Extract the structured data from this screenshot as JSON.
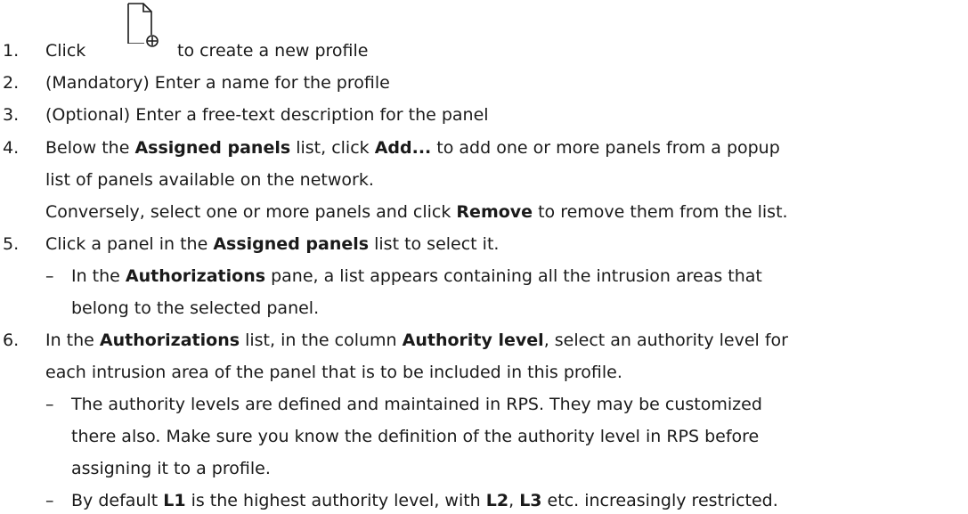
{
  "steps": {
    "s1": {
      "num": "1.",
      "a": "Click",
      "b": "to create a new profile"
    },
    "s2": {
      "num": "2.",
      "a": "(Mandatory) Enter a name for the profile"
    },
    "s3": {
      "num": "3.",
      "a": "(Optional) Enter a free-text description for the panel"
    },
    "s4": {
      "num": "4.",
      "a": "Below the ",
      "b": "Assigned panels",
      "c": " list, click ",
      "d": "Add...",
      "e": " to add one or more panels from a popup",
      "l2": "list of panels available on the network.",
      "l3a": "Conversely, select one or more panels and click ",
      "l3b": "Remove",
      "l3c": " to remove them from the list."
    },
    "s5": {
      "num": "5.",
      "a": "Click a panel in the ",
      "b": "Assigned panels",
      "c": " list to select it.",
      "dash": "–",
      "sa": "In the ",
      "sb": "Authorizations",
      "sc": " pane, a list appears containing all the intrusion areas that",
      "s2": "belong to the selected panel."
    },
    "s6": {
      "num": "6.",
      "a": "In the ",
      "b": "Authorizations",
      "c": " list, in the column ",
      "d": "Authority level",
      "e": ", select an authority level for",
      "l2": "each intrusion area of the panel that is to be included in this profile.",
      "dash": "–",
      "x1": "The authority levels are defined and maintained in RPS. They may be customized",
      "x2": "there also. Make sure you know the definition of the authority level in RPS before",
      "x3": "assigning it to a profile.",
      "ya": "By default ",
      "yb": "L1",
      "yc": " is the highest authority level, with ",
      "yd": "L2",
      "ye": ", ",
      "yf": "L3",
      "yg": " etc. increasingly restricted."
    }
  },
  "icons": {
    "new_profile": "new-document-plus-icon"
  }
}
